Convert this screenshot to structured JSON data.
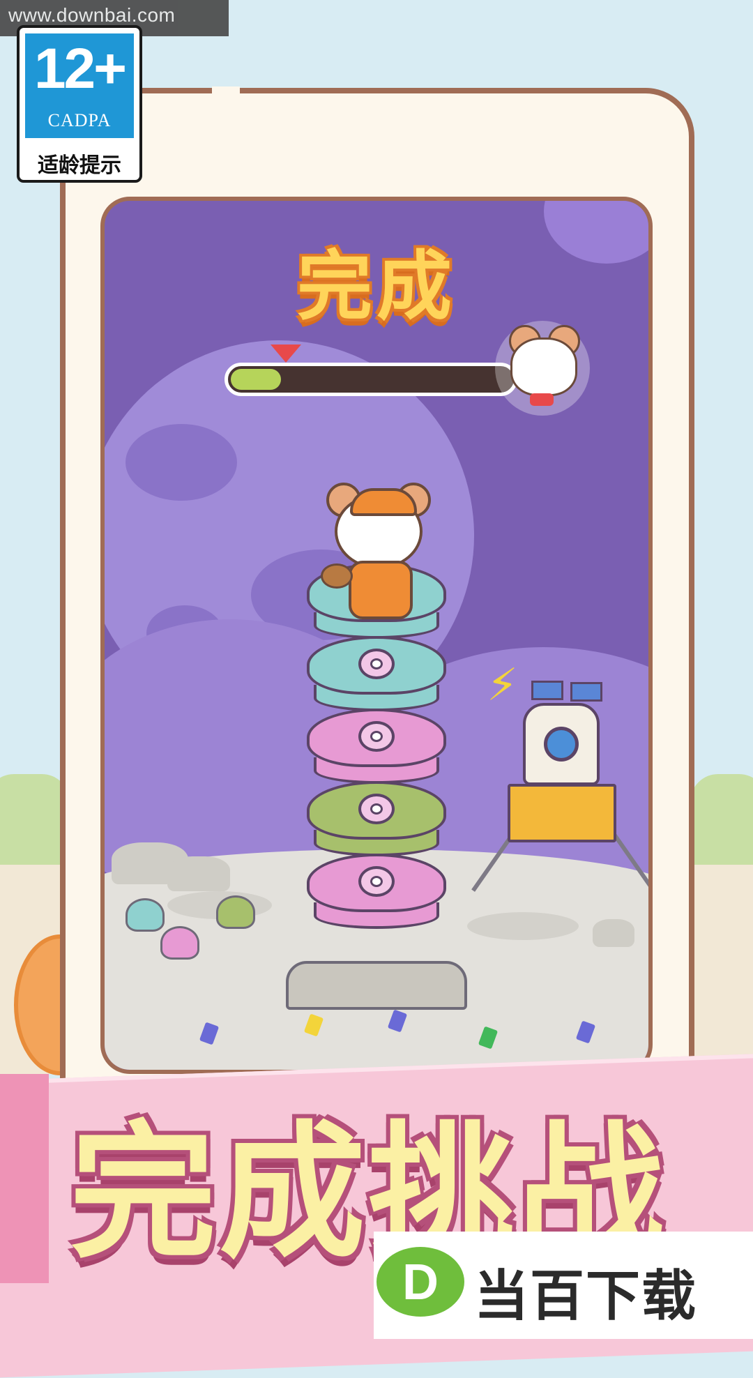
{
  "watermark_top": "www.downbai.com",
  "age_rating": {
    "number": "12+",
    "org": "CADPA",
    "tip": "适龄提示"
  },
  "game": {
    "title": "完成",
    "progress_fraction": 0.18,
    "stack": [
      {
        "color": "#8fd1cf"
      },
      {
        "color": "#8fd1cf"
      },
      {
        "color": "#e79ad3"
      },
      {
        "color": "#a7c06c"
      },
      {
        "color": "#e79ad3"
      }
    ]
  },
  "banner": {
    "text": "完成挑战"
  },
  "brand": {
    "logo_letter": "D",
    "name": "当百下载"
  }
}
